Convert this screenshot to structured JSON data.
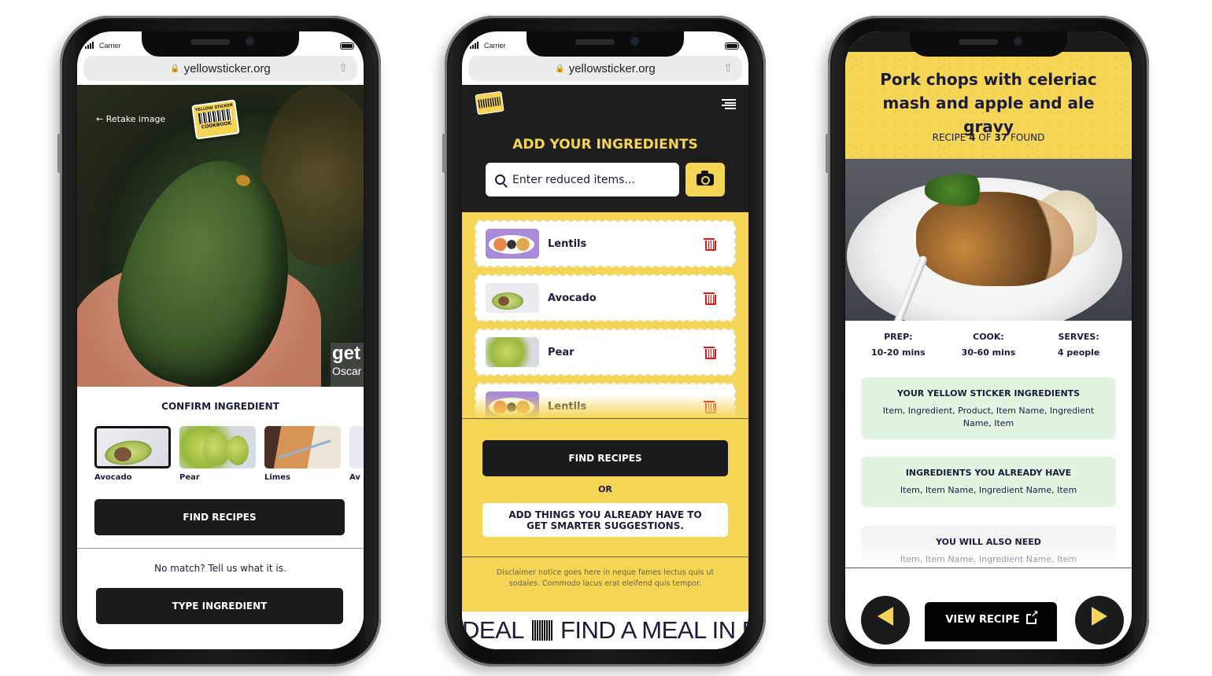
{
  "status_bar": {
    "carrier": "Carrier"
  },
  "browser": {
    "url": "yellowsticker.org"
  },
  "phone1": {
    "retake_label": "Retake image",
    "sticker": {
      "top": "YELLOW STICKER",
      "bottom": "COOKBOOK"
    },
    "watermark": {
      "line1": "get",
      "line2": "Oscar"
    },
    "confirm_title": "CONFIRM INGREDIENT",
    "options": [
      {
        "label": "Avocado",
        "selected": true
      },
      {
        "label": "Pear",
        "selected": false
      },
      {
        "label": "Limes",
        "selected": false
      },
      {
        "label": "Av",
        "selected": false
      }
    ],
    "find_recipes_label": "FIND RECIPES",
    "no_match_text": "No match? Tell us what it is.",
    "type_ingredient_label": "TYPE INGREDIENT"
  },
  "phone2": {
    "title": "ADD YOUR INGREDIENTS",
    "search_placeholder": "Enter reduced items...",
    "ingredients": [
      {
        "name": "Lentils",
        "image": "lentils"
      },
      {
        "name": "Avocado",
        "image": "avocado"
      },
      {
        "name": "Pear",
        "image": "pear"
      },
      {
        "name": "Lentils",
        "image": "lentils"
      }
    ],
    "find_recipes_label": "FIND RECIPES",
    "or_label": "OR",
    "add_have_label": "ADD THINGS YOU ALREADY HAVE TO GET SMARTER SUGGESTIONS.",
    "disclaimer": "Disclaimer notice goes here in neque fames lectus quis ut sodales. Commodo lacus erat eleifend quis tempor.",
    "ticker_left": "DEAL",
    "ticker_right": "FIND A MEAL IN E"
  },
  "phone3": {
    "recipe_title": "Pork chops with celeriac mash and apple and ale gravy",
    "count": {
      "prefix": "RECIPE",
      "current": "4",
      "of": "OF",
      "total": "37",
      "suffix": "FOUND"
    },
    "meta": [
      {
        "label": "PREP:",
        "value": "10-20 mins"
      },
      {
        "label": "COOK:",
        "value": "30-60 mins"
      },
      {
        "label": "SERVES:",
        "value": "4 people"
      }
    ],
    "yellow_sticker": {
      "heading": "YOUR YELLOW STICKER INGREDIENTS",
      "items": "Item, Ingredient, Product, Item Name, Ingredient Name, Item"
    },
    "already_have": {
      "heading": "INGREDIENTS YOU ALREADY HAVE",
      "items": "Item, Item Name, Ingredient Name, Item"
    },
    "also_need": {
      "heading": "YOU WILL ALSO NEED",
      "items": "Item, Item Name, Ingredient Name, Item"
    },
    "view_recipe_label": "VIEW RECIPE"
  },
  "colors": {
    "brand_yellow": "#f5d556",
    "dark": "#1b1b1d",
    "navy_text": "#1c1b3a",
    "delete_red": "#e01818",
    "green_box": "#e3f4e3"
  }
}
